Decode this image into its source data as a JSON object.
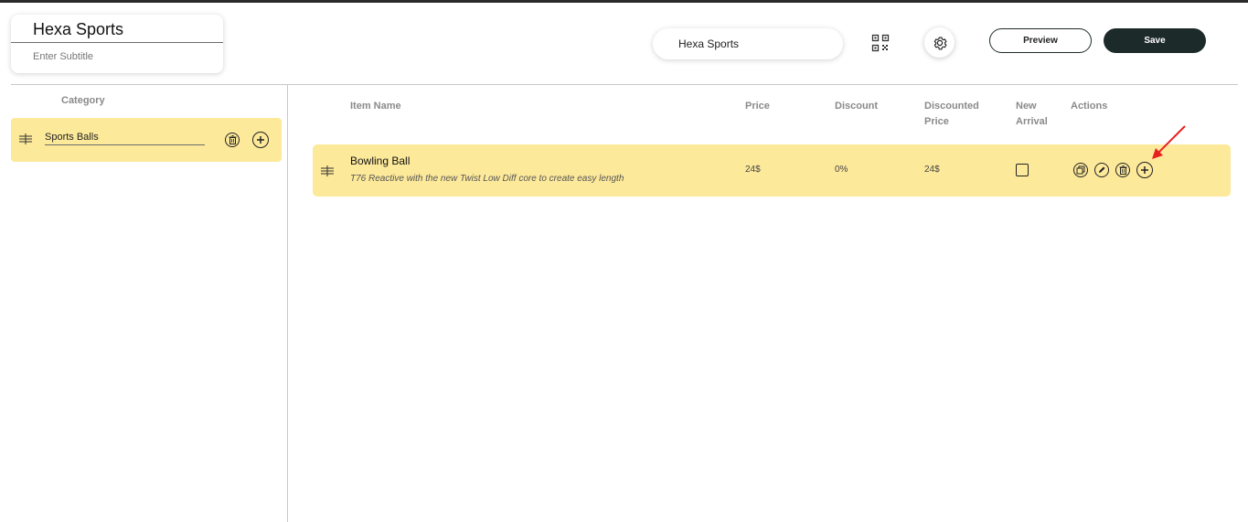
{
  "header": {
    "title": "Hexa Sports",
    "subtitle_placeholder": "Enter Subtitle",
    "menu_name": "Hexa Sports",
    "qr_icon": "qr-code-icon",
    "settings_icon": "gear-icon",
    "preview_label": "Preview",
    "save_label": "Save"
  },
  "sidebar": {
    "header": "Category",
    "categories": [
      {
        "name": "Sports Balls"
      }
    ]
  },
  "table": {
    "columns": {
      "item_name": "Item Name",
      "price": "Price",
      "discount": "Discount",
      "discounted_price_1": "Discounted",
      "discounted_price_2": "Price",
      "new_arrival_1": "New",
      "new_arrival_2": "Arrival",
      "actions": "Actions"
    },
    "rows": [
      {
        "name": "Bowling Ball",
        "description": "T76 Reactive with the new Twist Low Diff core to create easy length",
        "price": "24$",
        "discount": "0%",
        "discounted_price": "24$",
        "new_arrival": false
      }
    ]
  },
  "colors": {
    "row_highlight": "#fde99a",
    "save_bg": "#1d2a2a",
    "annotation_arrow": "#e8201e"
  }
}
